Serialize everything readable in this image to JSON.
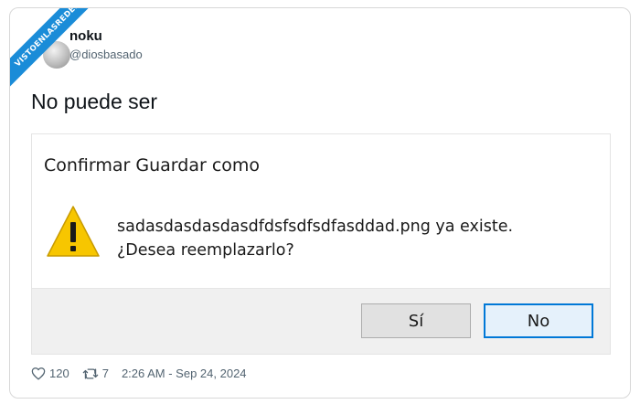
{
  "watermark": {
    "text": "VISTOENLASREDES"
  },
  "tweet": {
    "author_name": "noku",
    "author_handle": "@diosbasado",
    "text": "No puede ser",
    "likes": "120",
    "retweets": "7",
    "timestamp": "2:26 AM - Sep 24, 2024"
  },
  "dialog": {
    "title": "Confirmar Guardar como",
    "message_line1": "sadasdasdasdasdfdsfsdfsdfasddad.png ya existe.",
    "message_line2": "¿Desea reemplazarlo?",
    "yes_label": "Sí",
    "no_label": "No",
    "icon": "warning-icon"
  },
  "colors": {
    "banner": "#1a8cd8",
    "warning_yellow": "#f7c600",
    "focus_border": "#0078d7",
    "footer_bg": "#f0f0f0"
  }
}
